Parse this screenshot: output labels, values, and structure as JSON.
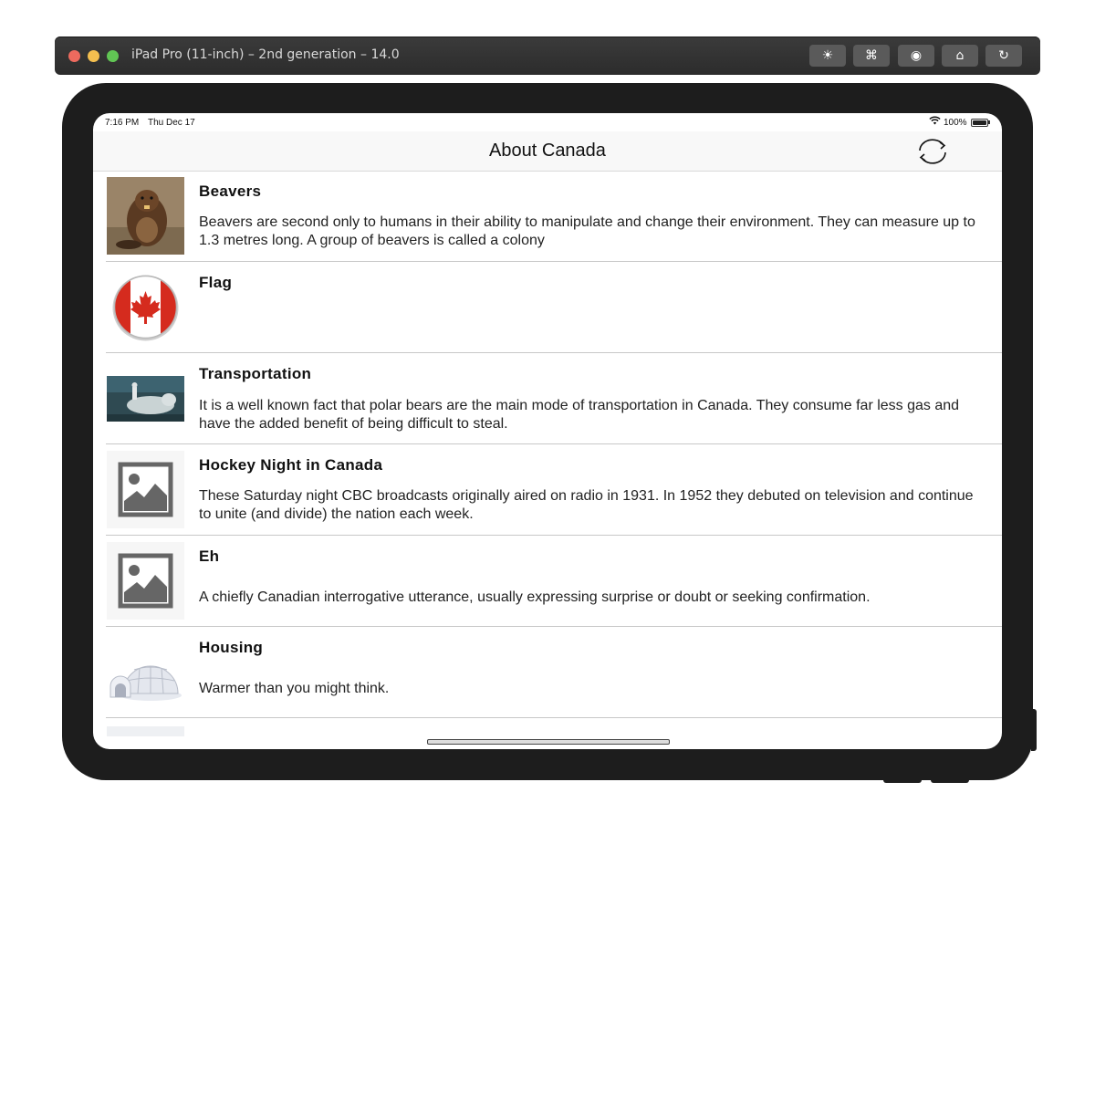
{
  "simulator": {
    "title": "iPad Pro (11-inch) – 2nd generation – 14.0",
    "toolbar": [
      {
        "icon": "brightness-icon",
        "glyph": "☀"
      },
      {
        "icon": "command-icon",
        "glyph": "⌘"
      },
      {
        "icon": "screenshot-icon",
        "glyph": "◉"
      },
      {
        "icon": "home-icon",
        "glyph": "⌂"
      },
      {
        "icon": "rotate-icon",
        "glyph": "↻"
      }
    ]
  },
  "status_bar": {
    "time": "7:16 PM",
    "date": "Thu Dec 17",
    "battery": "100%"
  },
  "nav": {
    "title": "About Canada",
    "refresh_icon": "refresh-icon"
  },
  "rows": [
    {
      "title": "Beavers",
      "description": "Beavers are second only to humans in their ability to manipulate and change their environment. They can measure up to 1.3 metres long. A group of beavers is called a colony",
      "image": "beaver"
    },
    {
      "title": "Flag",
      "description": "",
      "image": "flag"
    },
    {
      "title": "Transportation",
      "description": "It is a well known fact that polar bears are the main mode of transportation in Canada. They consume far less gas and have the added benefit of being difficult to steal.",
      "image": "polar-bear"
    },
    {
      "title": "Hockey Night in Canada",
      "description": "These Saturday night CBC broadcasts originally aired on radio in 1931. In 1952 they debuted on television and continue to unite (and divide) the nation each week.",
      "image": "placeholder"
    },
    {
      "title": "Eh",
      "description": "A chiefly Canadian interrogative utterance, usually expressing surprise or doubt or seeking confirmation.",
      "image": "placeholder"
    },
    {
      "title": "Housing",
      "description": "Warmer than you might think.",
      "image": "igloo"
    }
  ]
}
